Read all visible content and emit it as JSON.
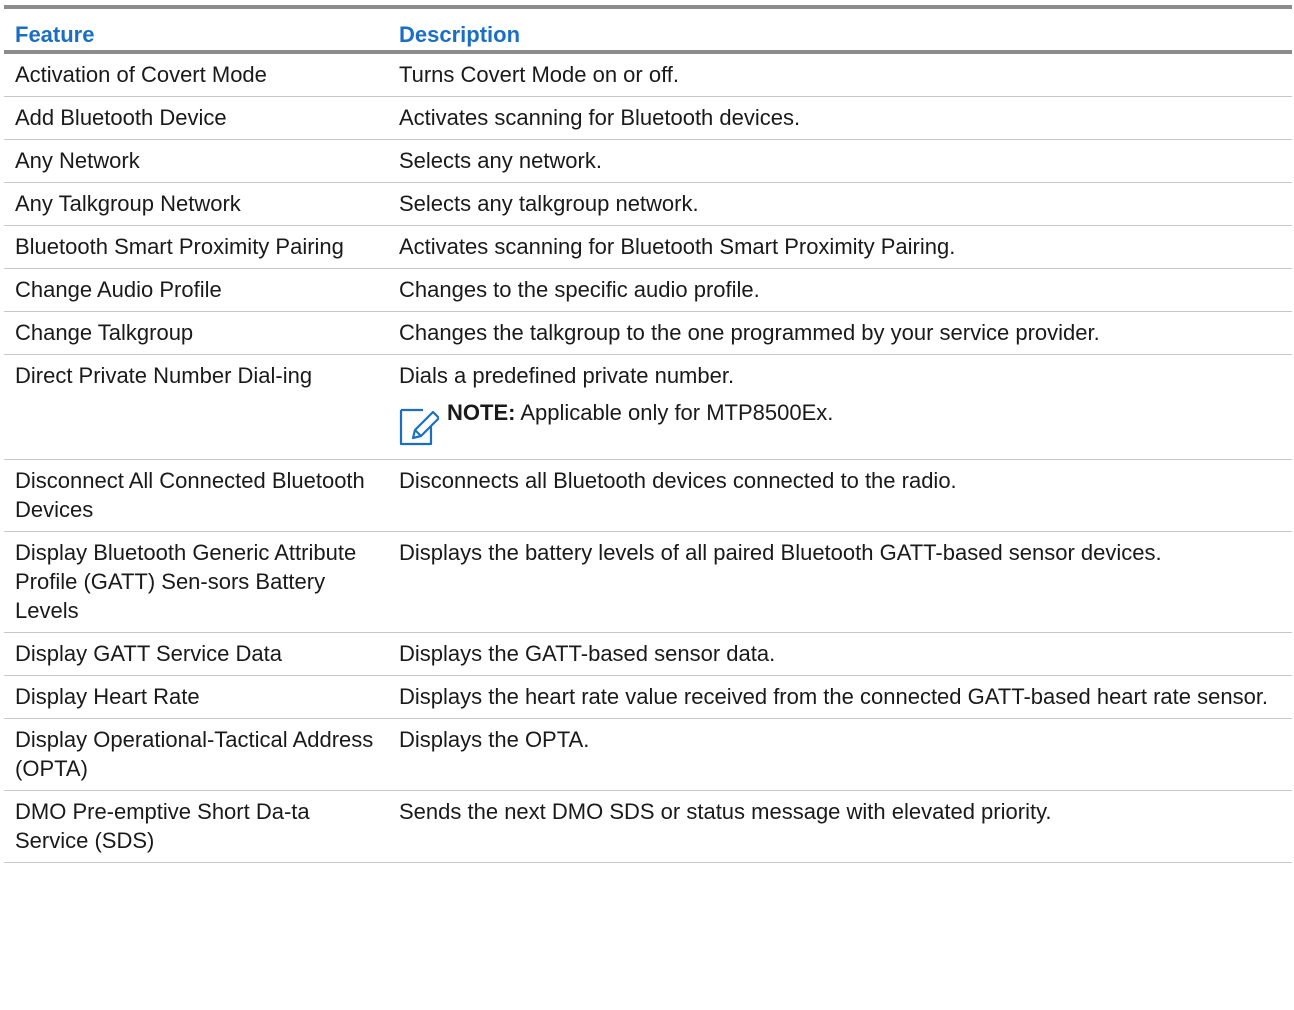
{
  "table": {
    "headers": {
      "feature": "Feature",
      "description": "Description"
    },
    "rows": [
      {
        "feature": "Activation of Covert Mode",
        "description": "Turns Covert Mode on or off."
      },
      {
        "feature": "Add Bluetooth Device",
        "description": "Activates scanning for Bluetooth devices."
      },
      {
        "feature": "Any Network",
        "description": "Selects any network."
      },
      {
        "feature": "Any Talkgroup Network",
        "description": "Selects any talkgroup network."
      },
      {
        "feature": "Bluetooth Smart Proximity Pairing",
        "description": "Activates scanning for Bluetooth Smart Proximity Pairing."
      },
      {
        "feature": "Change Audio Profile",
        "description": "Changes to the specific audio profile."
      },
      {
        "feature": "Change Talkgroup",
        "description": "Changes the talkgroup to the one programmed by your service provider."
      },
      {
        "feature": "Direct Private Number Dial-ing",
        "description": "Dials a predefined private number.",
        "note_label": "NOTE:",
        "note_text": " Applicable only for MTP8500Ex.",
        "note_icon": "note-pencil-icon"
      },
      {
        "feature": "Disconnect All Connected Bluetooth Devices",
        "description": "Disconnects all Bluetooth devices connected to the radio."
      },
      {
        "feature": "Display Bluetooth Generic Attribute Profile (GATT) Sen-sors Battery Levels",
        "description": "Displays the battery levels of all paired Bluetooth GATT-based sensor devices."
      },
      {
        "feature": "Display GATT Service Data",
        "description": "Displays the GATT-based sensor data."
      },
      {
        "feature": "Display Heart Rate",
        "description": "Displays the heart rate value received from the connected GATT-based heart rate sensor."
      },
      {
        "feature": "Display Operational-Tactical Address (OPTA)",
        "description": "Displays the OPTA."
      },
      {
        "feature": "DMO Pre-emptive Short Da-ta Service (SDS)",
        "description": "Sends the next DMO SDS or status message with elevated priority."
      }
    ]
  },
  "colors": {
    "header_text": "#1a6fc4",
    "rule": "#8c8c8c",
    "row_divider": "#c8c8c8",
    "note_icon": "#1a6fc4"
  }
}
